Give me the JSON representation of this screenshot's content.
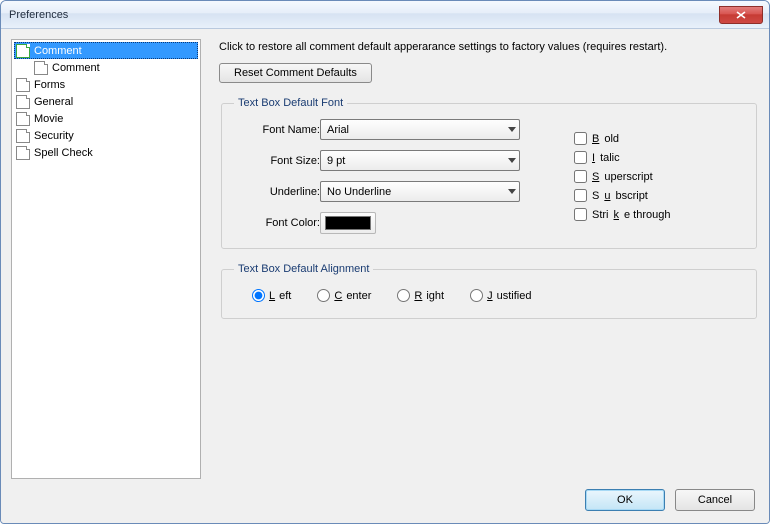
{
  "window": {
    "title": "Preferences"
  },
  "tree": {
    "items": [
      {
        "label": "Comment",
        "iconGreen": true,
        "selected": true
      },
      {
        "label": "Comment",
        "child": true
      },
      {
        "label": "Forms"
      },
      {
        "label": "General"
      },
      {
        "label": "Movie"
      },
      {
        "label": "Security"
      },
      {
        "label": "Spell Check"
      }
    ]
  },
  "main": {
    "description": "Click to restore all comment default apperarance settings to factory values (requires restart).",
    "resetButton": "Reset Comment Defaults",
    "fontGroup": {
      "legend": "Text Box Default Font",
      "fontNameLabel": "Font Name:",
      "fontNameValue": "Arial",
      "fontSizeLabel": "Font Size:",
      "fontSizeValue": "9 pt",
      "underlineLabel": "Underline:",
      "underlineValue": "No Underline",
      "fontColorLabel": "Font Color:",
      "checks": {
        "bold": "Bold",
        "italic": "Italic",
        "superscript": "Superscript",
        "subscript": "Subscript",
        "strike": "Strike through"
      }
    },
    "alignGroup": {
      "legend": "Text Box Default Alignment",
      "left": "Left",
      "center": "Center",
      "right": "Right",
      "justified": "Justified",
      "selected": "left"
    }
  },
  "footer": {
    "ok": "OK",
    "cancel": "Cancel"
  }
}
